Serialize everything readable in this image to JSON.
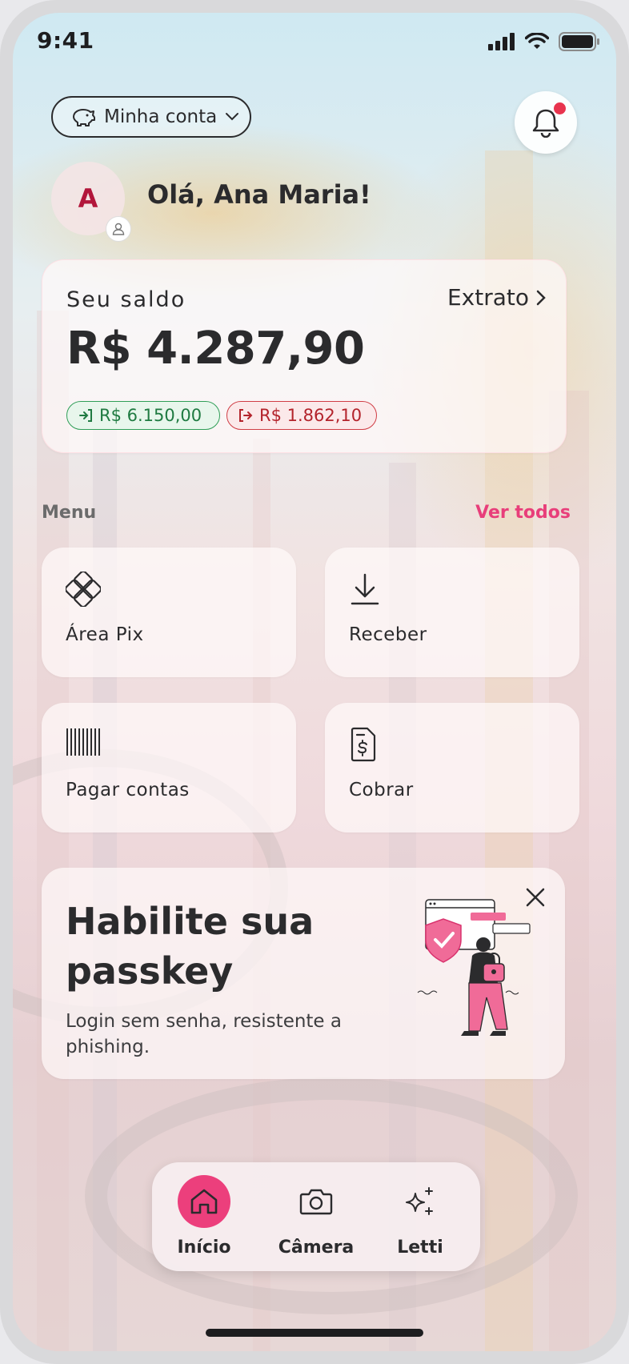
{
  "status_bar": {
    "time": "9:41",
    "icons": [
      "signal-icon",
      "wifi-icon",
      "battery-icon"
    ]
  },
  "header": {
    "account_label": "Minha conta",
    "account_icon": "piggy-bank-icon",
    "notification_icon": "bell-icon",
    "has_unread": true
  },
  "profile": {
    "initial": "A",
    "greeting": "Olá, Ana Maria!"
  },
  "balance": {
    "label": "Seu saldo",
    "statement_link": "Extrato",
    "value": "R$ 4.287,90",
    "income": "R$ 6.150,00",
    "expense": "R$ 1.862,10"
  },
  "menu": {
    "title": "Menu",
    "see_all": "Ver todos",
    "items": [
      {
        "label": "Área Pix",
        "icon": "pix-icon"
      },
      {
        "label": "Receber",
        "icon": "download-icon"
      },
      {
        "label": "Pagar contas",
        "icon": "barcode-icon"
      },
      {
        "label": "Cobrar",
        "icon": "invoice-dollar-icon"
      }
    ]
  },
  "promo": {
    "title": "Habilite sua passkey",
    "subtitle": "Login sem senha, resistente a phishing."
  },
  "bottom_nav": {
    "items": [
      {
        "label": "Início",
        "icon": "home-icon",
        "active": true
      },
      {
        "label": "Câmera",
        "icon": "camera-icon",
        "active": false
      },
      {
        "label": "Letti",
        "icon": "sparkles-icon",
        "active": false
      }
    ]
  },
  "colors": {
    "accent": "#ec3f7c",
    "income": "#1f7a41",
    "expense": "#b3232b",
    "avatar_text": "#b2163b"
  }
}
